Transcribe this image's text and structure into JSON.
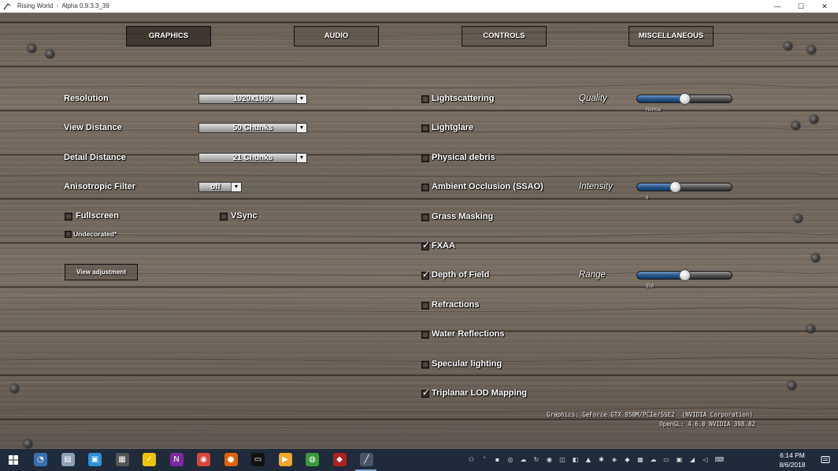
{
  "window": {
    "title": "Rising World  -  Alpha 0.9.3.3_39",
    "minimize_glyph": "—",
    "maximize_glyph": "☐",
    "close_glyph": "✕"
  },
  "tabs": [
    {
      "label": "GRAPHICS",
      "active": true
    },
    {
      "label": "AUDIO",
      "active": false
    },
    {
      "label": "CONTROLS",
      "active": false
    },
    {
      "label": "MISCELLANEOUS",
      "active": false
    }
  ],
  "left": {
    "resolution": {
      "label": "Resolution",
      "value": "1920x1080"
    },
    "view_distance": {
      "label": "View Distance",
      "value": "50 Chunks"
    },
    "detail_distance": {
      "label": "Detail Distance",
      "value": "21 Chunks"
    },
    "anisotropic": {
      "label": "Anisotropic Filter",
      "value": "off"
    },
    "fullscreen": {
      "label": "Fullscreen",
      "checked": false
    },
    "vsync": {
      "label": "VSync",
      "checked": false
    },
    "undecorated": {
      "label": "Undecorated*",
      "checked": false
    },
    "view_adjustment": {
      "label": "View adjustment"
    },
    "arrow_glyph": "▼"
  },
  "options": [
    {
      "label": "Lightscattering",
      "checked": false
    },
    {
      "label": "Lightglare",
      "checked": false
    },
    {
      "label": "Physical debris",
      "checked": false
    },
    {
      "label": "Ambient Occlusion (SSAO)",
      "checked": false
    },
    {
      "label": "Grass Masking",
      "checked": false
    },
    {
      "label": "FXAA",
      "checked": true
    },
    {
      "label": "Depth of Field",
      "checked": true
    },
    {
      "label": "Refractions",
      "checked": false
    },
    {
      "label": "Water Reflections",
      "checked": false
    },
    {
      "label": "Specular lighting",
      "checked": false
    },
    {
      "label": "Triplanar LOD Mapping",
      "checked": true
    }
  ],
  "check_glyph": "✓",
  "sliders": {
    "quality": {
      "label": "Quality",
      "value_text": "Normal",
      "fraction": 0.5
    },
    "intensity": {
      "label": "Intensity",
      "value_text": "8",
      "fraction": 0.4
    },
    "range": {
      "label": "Range",
      "value_text": "358",
      "fraction": 0.5
    }
  },
  "info": {
    "graphics": "Graphics: GeForce GTX 950M/PCIe/SSE2  (NVIDIA Corporation)",
    "opengl": "OpenGL: 4.6.0 NVIDIA 398.82"
  },
  "taskbar": {
    "time": "6:14 PM",
    "date": "8/6/2018",
    "start_icon": "windows-logo-icon",
    "apps": [
      {
        "name": "paint-icon",
        "color": "#3a6fb0",
        "glyph": "◔"
      },
      {
        "name": "explorer-icon",
        "color": "#8aa0b8",
        "glyph": "▤"
      },
      {
        "name": "photos-icon",
        "color": "#2f8fd6",
        "glyph": "▣"
      },
      {
        "name": "calculator-icon",
        "color": "#555",
        "glyph": "▦"
      },
      {
        "name": "norton-icon",
        "color": "#f2c300",
        "glyph": "✓"
      },
      {
        "name": "onenote-icon",
        "color": "#7a2a9e",
        "glyph": "N"
      },
      {
        "name": "chrome-icon",
        "color": "#db4437",
        "glyph": "◉"
      },
      {
        "name": "firefox-icon",
        "color": "#e66000",
        "glyph": "●"
      },
      {
        "name": "terminal-icon",
        "color": "#111",
        "glyph": "▭"
      },
      {
        "name": "media-player-icon",
        "color": "#f5a623",
        "glyph": "▶"
      },
      {
        "name": "globe-icon",
        "color": "#3c9a3c",
        "glyph": "◍"
      },
      {
        "name": "razer-icon",
        "color": "#b02020",
        "glyph": "◆"
      },
      {
        "name": "rising-world-icon",
        "color": "#4a5566",
        "glyph": "╱"
      }
    ],
    "tray": [
      "person-icon",
      "chevron-up-icon",
      "tray-app-icon",
      "search-tray-icon",
      "cloud-icon",
      "sync-icon",
      "norton-tray-icon",
      "phone-icon",
      "media-tray-icon",
      "nvidia-icon",
      "bluetooth-icon",
      "shield-tray-icon",
      "dropbox-icon",
      "network-icon",
      "onedrive-icon",
      "monitor-icon",
      "display-icon",
      "wifi-icon",
      "volume-icon",
      "language-icon"
    ],
    "notification_icon": "notification-icon"
  }
}
